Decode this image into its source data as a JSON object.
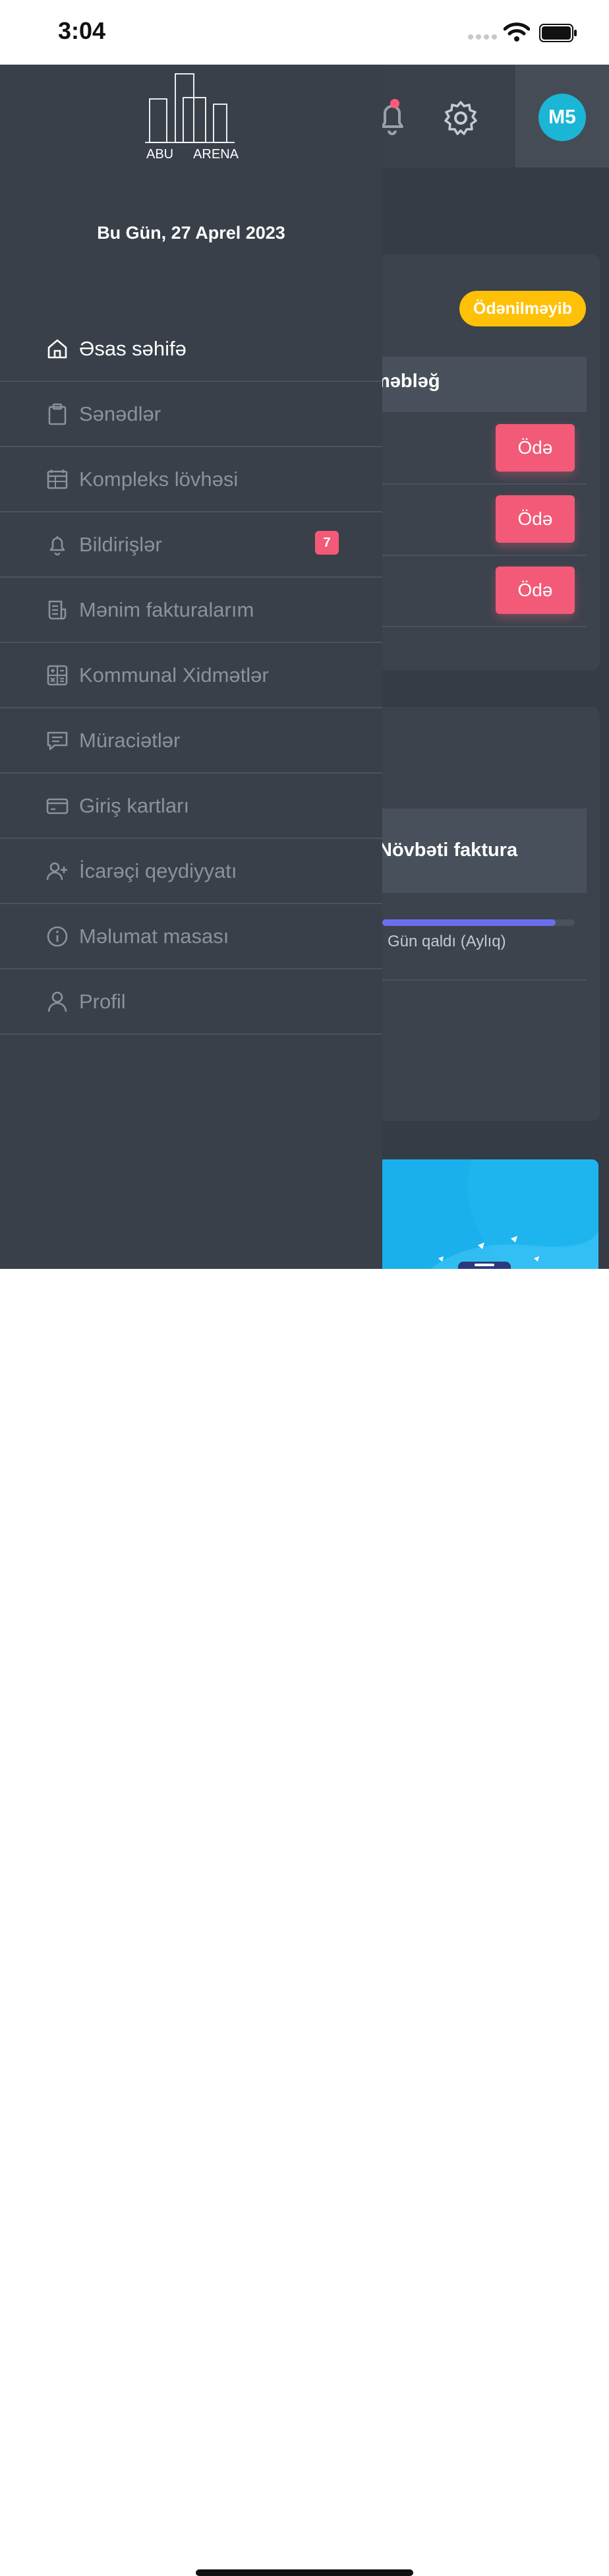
{
  "status_bar": {
    "time": "3:04"
  },
  "header": {
    "avatar_initials": "M5"
  },
  "invoice_card": {
    "status_badge": "Ödənilməyib",
    "column_header": "məbləğ",
    "pay_button_label": "Ödə",
    "rows": [
      {
        "action": "Ödə"
      },
      {
        "action": "Ödə"
      },
      {
        "action": "Ödə"
      }
    ]
  },
  "billing_card": {
    "column_header": "Növbəti faktura",
    "progress_label": "Gün qaldı (Aylıq)",
    "progress_fraction": 0.9
  },
  "drawer": {
    "logo_words": [
      "ABU",
      "ARENA"
    ],
    "today": "Bu Gün, 27 Aprel 2023",
    "menu": [
      {
        "id": "home",
        "label": "Əsas səhifə",
        "icon": "home-icon",
        "active": true
      },
      {
        "id": "documents",
        "label": "Sənədlər",
        "icon": "clipboard-icon",
        "active": false
      },
      {
        "id": "complex-board",
        "label": "Kompleks lövhəsi",
        "icon": "calendar-board-icon",
        "active": false
      },
      {
        "id": "notifications",
        "label": "Bildirişlər",
        "icon": "bell-icon",
        "active": false,
        "badge": "7"
      },
      {
        "id": "invoices",
        "label": "Mənim fakturalarım",
        "icon": "receipt-icon",
        "active": false
      },
      {
        "id": "utilities",
        "label": "Kommunal Xidmətlər",
        "icon": "calculator-icon",
        "active": false
      },
      {
        "id": "requests",
        "label": "Müraciətlər",
        "icon": "message-icon",
        "active": false
      },
      {
        "id": "access-cards",
        "label": "Giriş kartları",
        "icon": "credit-card-icon",
        "active": false
      },
      {
        "id": "tenant-registration",
        "label": "İcarəçi qeydiyyatı",
        "icon": "user-plus-icon",
        "active": false
      },
      {
        "id": "info-desk",
        "label": "Məlumat masası",
        "icon": "info-icon",
        "active": false
      },
      {
        "id": "profile",
        "label": "Profil",
        "icon": "user-icon",
        "active": false
      }
    ]
  },
  "colors": {
    "drawer_bg": "#394049",
    "content_bg": "#353c45",
    "accent_pink": "#f25a78",
    "badge_yellow": "#ffc107",
    "avatar_cyan": "#1bb6d6",
    "progress_purple": "#6c6ef0"
  }
}
